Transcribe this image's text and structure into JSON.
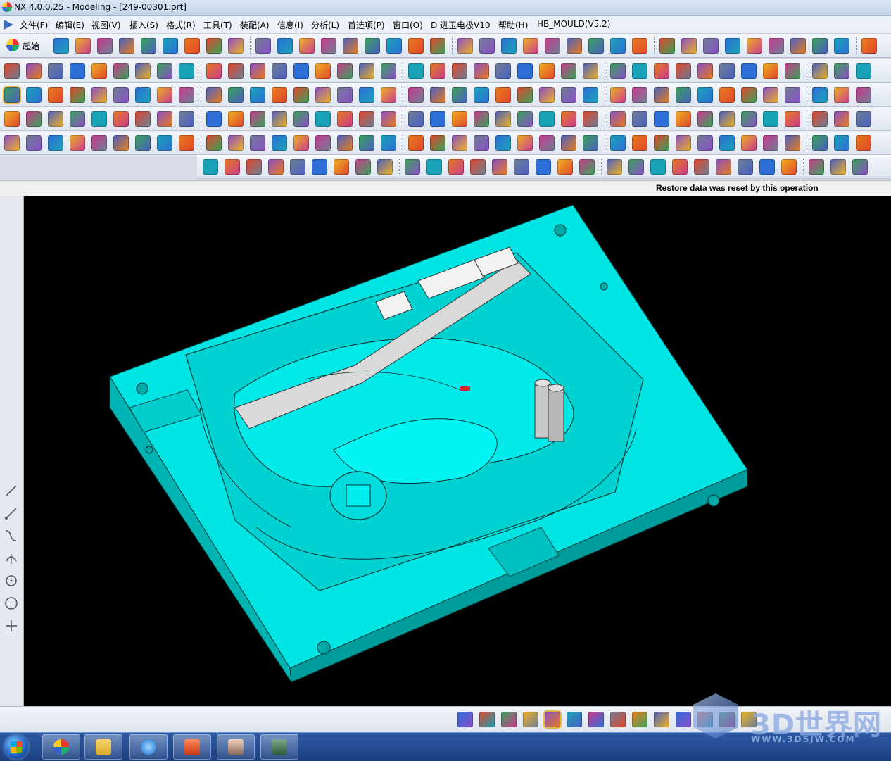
{
  "window": {
    "title": "NX 4.0.0.25 - Modeling - [249-00301.prt]"
  },
  "menubar": {
    "items": [
      "文件(F)",
      "编辑(E)",
      "视图(V)",
      "插入(S)",
      "格式(R)",
      "工具(T)",
      "装配(A)",
      "信息(I)",
      "分析(L)",
      "首选项(P)",
      "窗口(O)",
      "D 进玉电极V10",
      "帮助(H)",
      "HB_MOULD(V5.2)"
    ]
  },
  "toolbar": {
    "start_label": "起始"
  },
  "status": {
    "message": "Restore data was reset by this operation"
  },
  "viewport": {
    "background": "#000000",
    "model_color": "#00e0e0",
    "model": "mold-plate"
  },
  "watermark": {
    "brand": "3D世界网",
    "url": "WWW.3DSJW.COM"
  },
  "taskbar": {
    "apps": [
      "nx-icon",
      "explorer-icon",
      "ie-icon",
      "office-icon",
      "user-photo-icon",
      "monitor-icon"
    ]
  },
  "colors": {
    "accent": "#3a6fc4",
    "cyan": "#00e0e0"
  }
}
